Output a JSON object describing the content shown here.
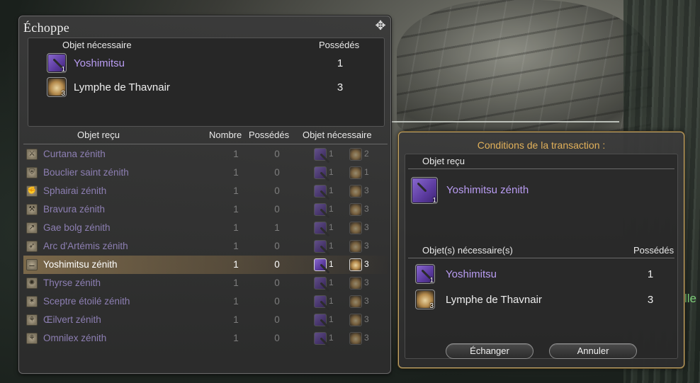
{
  "shop": {
    "title": "Échoppe",
    "close_icon": "✥",
    "needed_header": "Objet nécessaire",
    "owned_header": "Possédés",
    "needed_items": [
      {
        "name": "Yoshimitsu",
        "count": "1",
        "owned": "1",
        "icon": "weapon-icon",
        "style": "purple"
      },
      {
        "name": "Lymphe de Thavnair",
        "count": "3",
        "owned": "3",
        "icon": "jar-icon",
        "style": "white"
      }
    ],
    "columns": {
      "received": "Objet reçu",
      "number": "Nombre",
      "owned": "Possédés",
      "needed": "Objet nécessaire"
    },
    "rows": [
      {
        "name": "Curtana zénith",
        "number": "1",
        "owned": "0",
        "need1": "1",
        "need2": "2",
        "icon": "sword-icon",
        "glyph": "⚔"
      },
      {
        "name": "Bouclier saint zénith",
        "number": "1",
        "owned": "0",
        "need1": "1",
        "need2": "1",
        "icon": "shield-icon",
        "glyph": "⛨"
      },
      {
        "name": "Sphairai zénith",
        "number": "1",
        "owned": "0",
        "need1": "1",
        "need2": "3",
        "icon": "fist-icon",
        "glyph": "✊"
      },
      {
        "name": "Bravura zénith",
        "number": "1",
        "owned": "0",
        "need1": "1",
        "need2": "3",
        "icon": "axe-icon",
        "glyph": "⚒"
      },
      {
        "name": "Gae bolg zénith",
        "number": "1",
        "owned": "1",
        "need1": "1",
        "need2": "3",
        "icon": "lance-icon",
        "glyph": "↗"
      },
      {
        "name": "Arc d'Artémis zénith",
        "number": "1",
        "owned": "0",
        "need1": "1",
        "need2": "3",
        "icon": "bow-icon",
        "glyph": "➶"
      },
      {
        "name": "Yoshimitsu zénith",
        "number": "1",
        "owned": "0",
        "need1": "1",
        "need2": "3",
        "icon": "katana-icon",
        "glyph": "⚊",
        "selected": true
      },
      {
        "name": "Thyrse zénith",
        "number": "1",
        "owned": "0",
        "need1": "1",
        "need2": "3",
        "icon": "staff-icon",
        "glyph": "✺"
      },
      {
        "name": "Sceptre étoilé zénith",
        "number": "1",
        "owned": "0",
        "need1": "1",
        "need2": "3",
        "icon": "sceptre-icon",
        "glyph": "✶"
      },
      {
        "name": "Œilvert zénith",
        "number": "1",
        "owned": "0",
        "need1": "1",
        "need2": "3",
        "icon": "book-icon",
        "glyph": "⚘"
      },
      {
        "name": "Omnilex zénith",
        "number": "1",
        "owned": "0",
        "need1": "1",
        "need2": "3",
        "icon": "codex-icon",
        "glyph": "⚘"
      }
    ]
  },
  "conditions": {
    "title": "Conditions de la transaction :",
    "received_header": "Objet reçu",
    "received_item": {
      "name": "Yoshimitsu zénith",
      "count": "1"
    },
    "needed_header": "Objet(s) nécessaire(s)",
    "owned_header": "Possédés",
    "needed_items": [
      {
        "name": "Yoshimitsu",
        "count": "1",
        "owned": "1"
      },
      {
        "name": "Lymphe de Thavnair",
        "count": "3",
        "owned": "3"
      }
    ],
    "exchange_button": "Échanger",
    "cancel_button": "Annuler"
  },
  "background": {
    "fragment_text": "lle"
  },
  "colors": {
    "accent_gold": "#e2b15a",
    "item_purple": "#b99cf2",
    "selected_row": "#b89660"
  }
}
